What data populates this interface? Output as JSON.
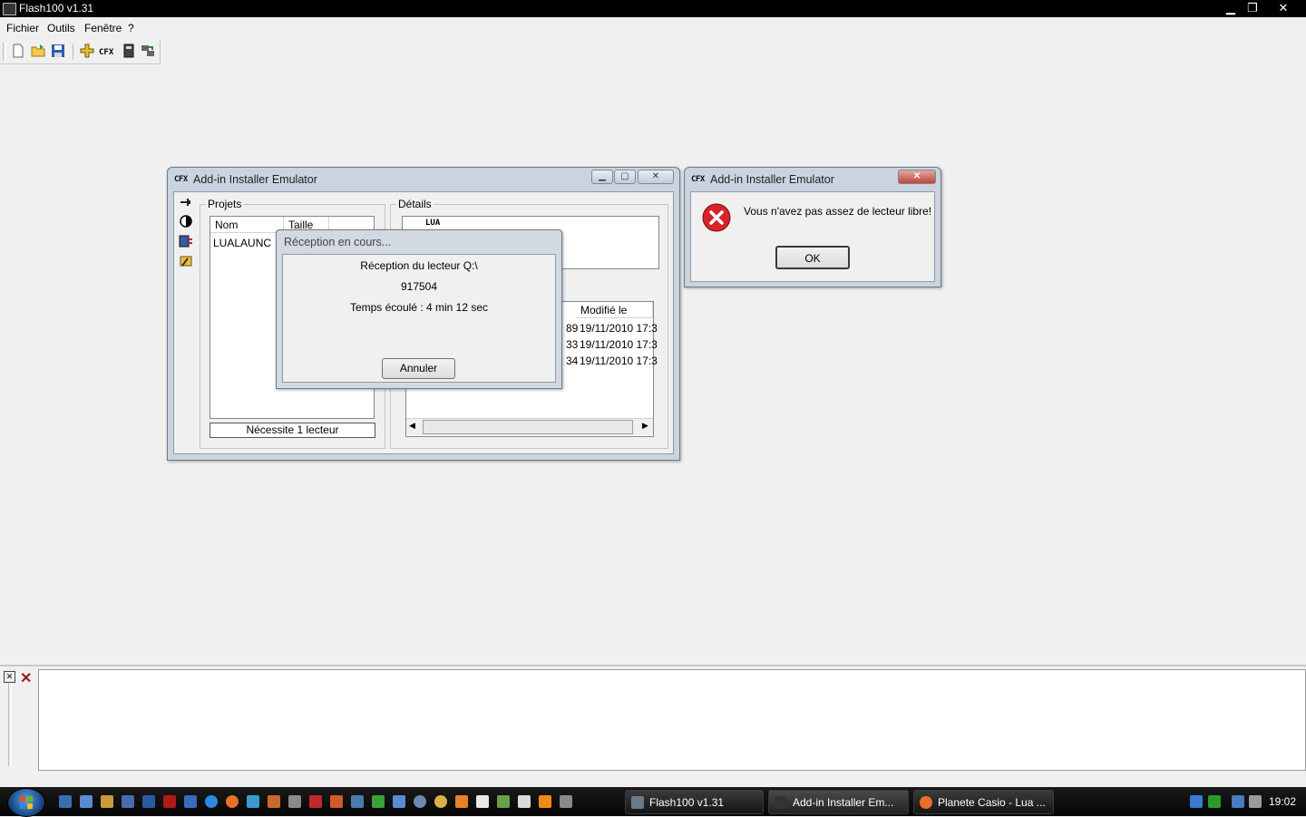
{
  "app": {
    "title": "Flash100 v1.31"
  },
  "menu": [
    "Fichier",
    "Outils",
    "Fenêtre",
    "?"
  ],
  "emulator": {
    "title": "Add-in Installer Emulator",
    "logo": "CFX",
    "projects_label": "Projets",
    "details_label": "Détails",
    "col_nom": "Nom",
    "col_taille": "Taille",
    "project_row": "LUALAUNC",
    "needs_label": "Nécessite 1 lecteur",
    "details_logo": "LUA",
    "col_modified": "Modifié le",
    "rows": [
      {
        "size_tail": "89",
        "date": "19/11/2010 17:3"
      },
      {
        "size_tail": "33",
        "date": "19/11/2010 17:3"
      },
      {
        "size_tail": "34",
        "date": "19/11/2010 17:3"
      }
    ]
  },
  "reception": {
    "title": "Réception en cours...",
    "line1": "Réception du lecteur Q:\\",
    "line2": "917504",
    "line3": "Temps écoulé : 4 min 12 sec",
    "cancel": "Annuler"
  },
  "error": {
    "title": "Add-in Installer Emulator",
    "logo": "CFX",
    "message": "Vous n'avez pas assez de lecteur libre!",
    "ok": "OK"
  },
  "taskbar": {
    "tasks": [
      "Flash100 v1.31",
      "Add-in Installer Em...",
      "Planete Casio - Lua ..."
    ],
    "clock": "19:02"
  },
  "colors": {
    "taskbar": "#0b0b0b",
    "error_icon": "#d8232a",
    "titlebar": "#000000"
  }
}
